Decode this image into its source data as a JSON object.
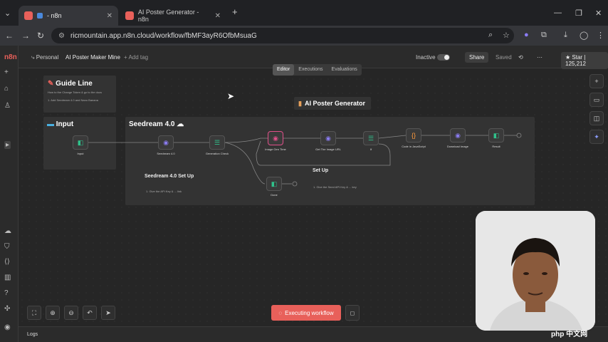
{
  "browser": {
    "tabs": [
      {
        "title": "- n8n",
        "active": true
      },
      {
        "title": "AI Poster Generator - n8n",
        "active": false
      }
    ],
    "url": "ricmountain.app.n8n.cloud/workflow/fbMF3ayR6OfbMsuaG"
  },
  "topbar": {
    "breadcrumb_parent": "Personal",
    "workflow_name": "AI Poster Maker Mine",
    "add_tag": "+ Add tag",
    "inactive_label": "Inactive",
    "share_label": "Share",
    "saved_label": "Saved",
    "star_label": "Star",
    "star_count": "125,212"
  },
  "mode_tabs": [
    "Editor",
    "Executions",
    "Evaluations"
  ],
  "canvas": {
    "guide_title": "Guide Line",
    "guide_text": "How to the Change Token & go to the docs",
    "guide_item": "1. Add Seedream 4.0 and Nano Banana",
    "input_title": "Input",
    "seedream_title": "Seedream 4.0 ☁",
    "poster_title": "AI Poster Generator",
    "setup_title": "Seedream 4.0 Set Up",
    "setup_item": "1. Give the API Key & ... link",
    "setup2_title": "Set Up",
    "setup2_item": "1. Give the Seed API Key & ... key",
    "nodes": [
      {
        "label": "Input",
        "icon": "◧",
        "color": "#2fc28b"
      },
      {
        "label": "Seedream 4.0",
        "icon": "◉",
        "color": "#8a7cf0"
      },
      {
        "label": "Generation Check",
        "icon": "☰",
        "color": "#2fc28b"
      },
      {
        "label": "Image Gen Time",
        "icon": "◉",
        "color": "#e0508a"
      },
      {
        "label": "Get The Image URL",
        "icon": "◉",
        "color": "#8a7cf0"
      },
      {
        "label": "If",
        "icon": "☰",
        "color": "#2fc28b"
      },
      {
        "label": "Code in JavaScript",
        "icon": "{}",
        "color": "#ff9a3c"
      },
      {
        "label": "Download Image",
        "icon": "◉",
        "color": "#8a7cf0"
      },
      {
        "label": "Result",
        "icon": "◧",
        "color": "#2fc28b"
      },
      {
        "label": "Done",
        "icon": "◧",
        "color": "#2fc28b"
      }
    ]
  },
  "execute_label": "Executing workflow",
  "logs_label": "Logs",
  "watermark": "php 中文网"
}
